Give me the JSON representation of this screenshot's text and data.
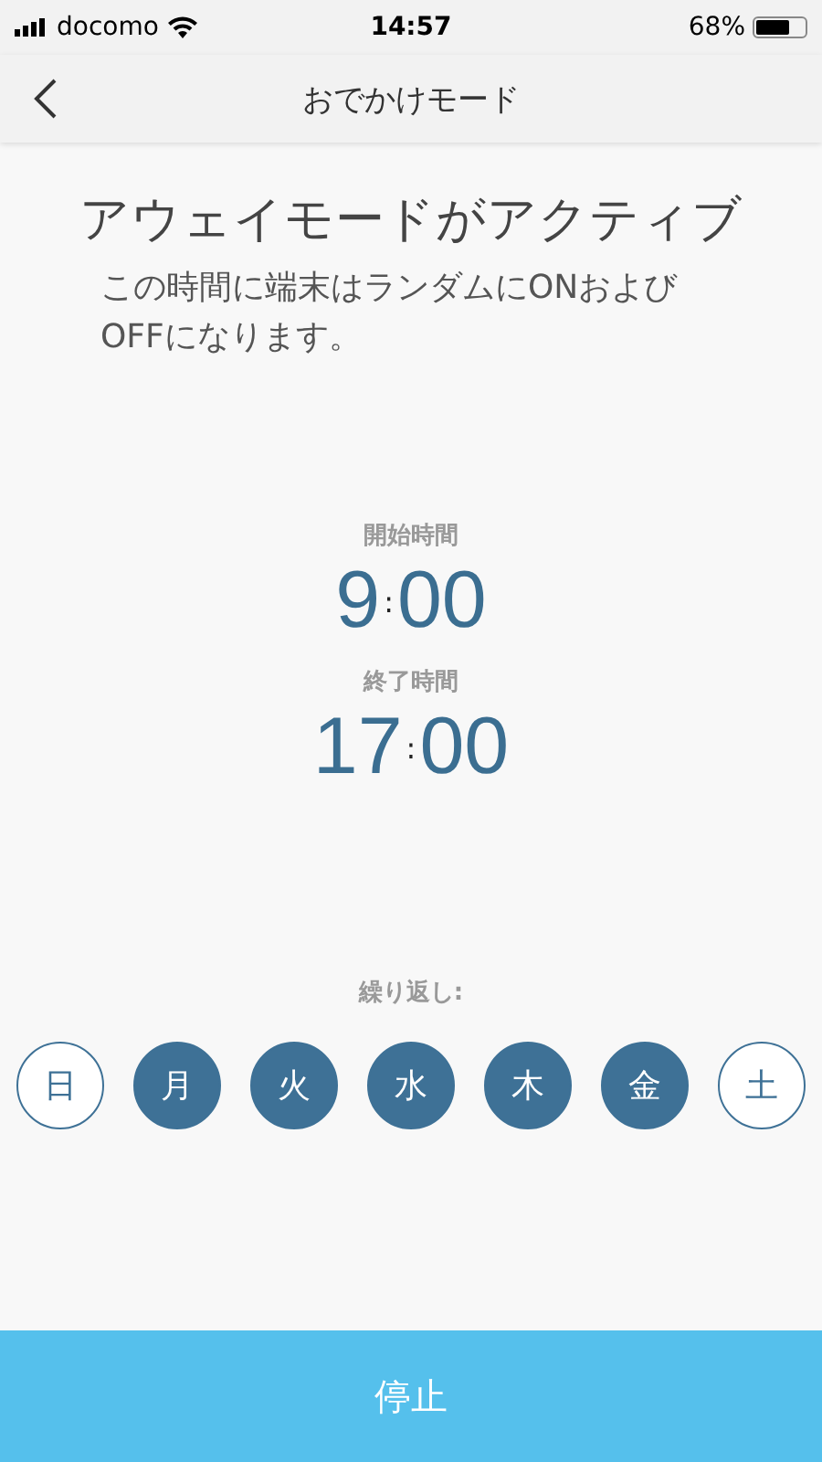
{
  "status_bar": {
    "carrier": "docomo",
    "time": "14:57",
    "battery": "68%"
  },
  "nav": {
    "title": "おでかけモード"
  },
  "heading": "アウェイモードがアクティブ",
  "description": "この時間に端末はランダムにONおよびOFFになります。",
  "times": [
    {
      "label": "開始時間",
      "hour": "9",
      "separator": ":",
      "minute": "00"
    },
    {
      "label": "終了時間",
      "hour": "17",
      "separator": ":",
      "minute": "00"
    }
  ],
  "repeat": {
    "label": "繰り返し:",
    "days": [
      {
        "label": "日",
        "selected": false
      },
      {
        "label": "月",
        "selected": true
      },
      {
        "label": "火",
        "selected": true
      },
      {
        "label": "水",
        "selected": true
      },
      {
        "label": "木",
        "selected": true
      },
      {
        "label": "金",
        "selected": true
      },
      {
        "label": "土",
        "selected": false
      }
    ]
  },
  "stop_button": "停止"
}
